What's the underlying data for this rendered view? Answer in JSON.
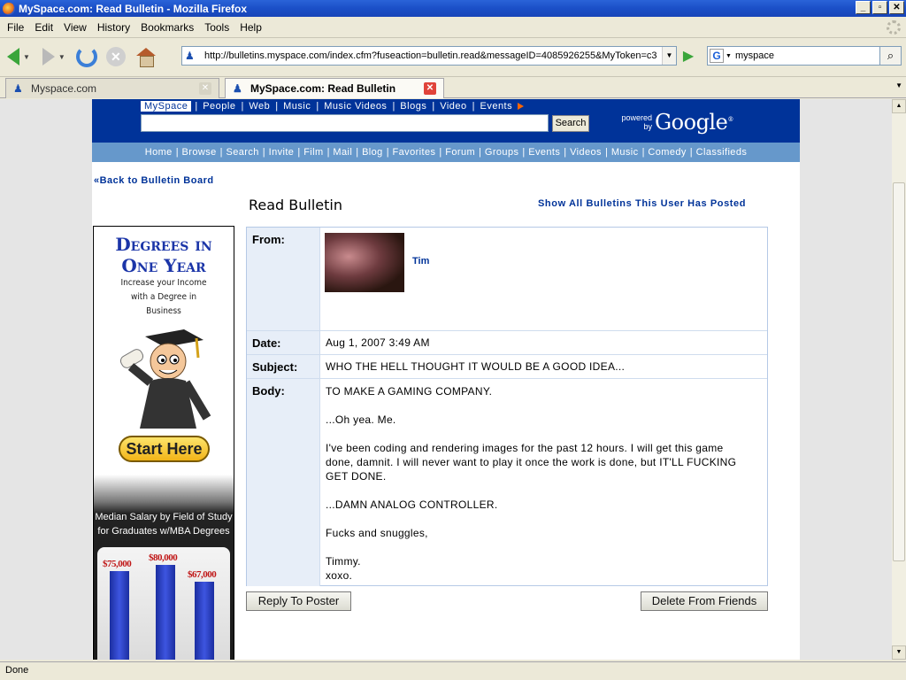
{
  "window": {
    "title": "MySpace.com: Read Bulletin - Mozilla Firefox"
  },
  "menu": [
    "File",
    "Edit",
    "View",
    "History",
    "Bookmarks",
    "Tools",
    "Help"
  ],
  "nav": {
    "url": "http://bulletins.myspace.com/index.cfm?fuseaction=bulletin.read&messageID=4085926255&MyToken=c3",
    "search_value": "myspace"
  },
  "tabs": [
    {
      "label": "Myspace.com"
    },
    {
      "label": "MySpace.com: Read Bulletin"
    }
  ],
  "myspace": {
    "toplinks": [
      "MySpace",
      "People",
      "Web",
      "Music",
      "Music Videos",
      "Blogs",
      "Video",
      "Events"
    ],
    "search_button": "Search",
    "powered_by": "powered by",
    "google": "Google",
    "subnav": [
      "Home",
      "Browse",
      "Search",
      "Invite",
      "Film",
      "Mail",
      "Blog",
      "Favorites",
      "Forum",
      "Groups",
      "Events",
      "Videos",
      "Music",
      "Comedy",
      "Classifieds"
    ]
  },
  "page": {
    "back_link": "«Back to Bulletin Board",
    "title": "Read Bulletin",
    "show_all": "Show All Bulletins This User Has Posted",
    "from_label": "From:",
    "from_name": "Tim",
    "date_label": "Date:",
    "date_value": "Aug 1, 2007 3:49 AM",
    "subject_label": "Subject:",
    "subject_value": "WHO THE HELL THOUGHT IT WOULD BE A GOOD IDEA...",
    "body_label": "Body:",
    "body": [
      "TO MAKE A GAMING COMPANY.",
      "...Oh yea. Me.",
      "I've been coding and rendering images for the past 12 hours. I will get this game done, damnit. I will never want to play it once the work is done, but IT'LL FUCKING GET DONE.",
      "...DAMN ANALOG CONTROLLER.",
      "Fucks and snuggles,",
      "Timmy.",
      "xoxo."
    ],
    "reply_button": "Reply To Poster",
    "delete_button": "Delete From Friends"
  },
  "ad": {
    "headline_1": "Degrees in",
    "headline_2": "One Year",
    "sub_1": "Increase your Income",
    "sub_2": "with a Degree in",
    "sub_3": "Business",
    "button": "Start Here",
    "chart_title_1": "Median Salary by Field of Study",
    "chart_title_2": "for Graduates w/MBA Degrees",
    "bars": [
      {
        "label": "$75,000",
        "value": 75000
      },
      {
        "label": "$80,000",
        "value": 80000
      },
      {
        "label": "$67,000",
        "value": 67000
      }
    ]
  },
  "status": {
    "text": "Done"
  },
  "colors": {
    "myspace_blue": "#003399",
    "subnav_blue": "#6698cb",
    "events_arrow": "#ff6600"
  }
}
